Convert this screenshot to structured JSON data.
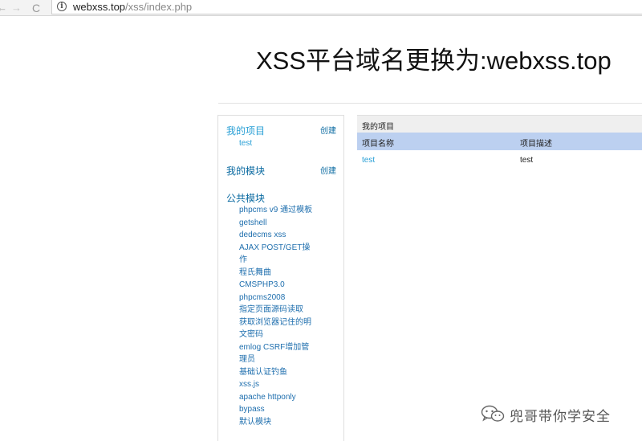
{
  "browser": {
    "back_icon": "←",
    "forward_icon": "→",
    "reload_icon": "C",
    "info_icon": "i",
    "url_host": "webxss.top",
    "url_path": "/xss/index.php"
  },
  "header": {
    "title": "XSS平台域名更换为:webxss.top"
  },
  "sidebar": {
    "my_projects": {
      "label": "我的项目",
      "create": "创建",
      "items": [
        "test"
      ]
    },
    "my_modules": {
      "label": "我的模块",
      "create": "创建"
    },
    "public_modules": {
      "label": "公共模块",
      "items": [
        "phpcms v9 通过模板",
        "getshell",
        "dedecms xss",
        "AJAX POST/GET操",
        "作",
        "程氏舞曲",
        "CMSPHP3.0",
        "phpcms2008",
        "指定页面源码读取",
        "获取浏览器记住的明",
        "文密码",
        "emlog CSRF增加管",
        "理员",
        "基础认证钓鱼",
        "xss.js",
        "apache httponly",
        "bypass",
        "默认模块"
      ]
    }
  },
  "main": {
    "panel_title": "我的项目",
    "columns": [
      "项目名称",
      "项目描述"
    ],
    "rows": [
      {
        "name": "test",
        "description": "test"
      }
    ]
  },
  "watermark": {
    "text": "兜哥带你学安全",
    "icon": "wechat-icon"
  }
}
